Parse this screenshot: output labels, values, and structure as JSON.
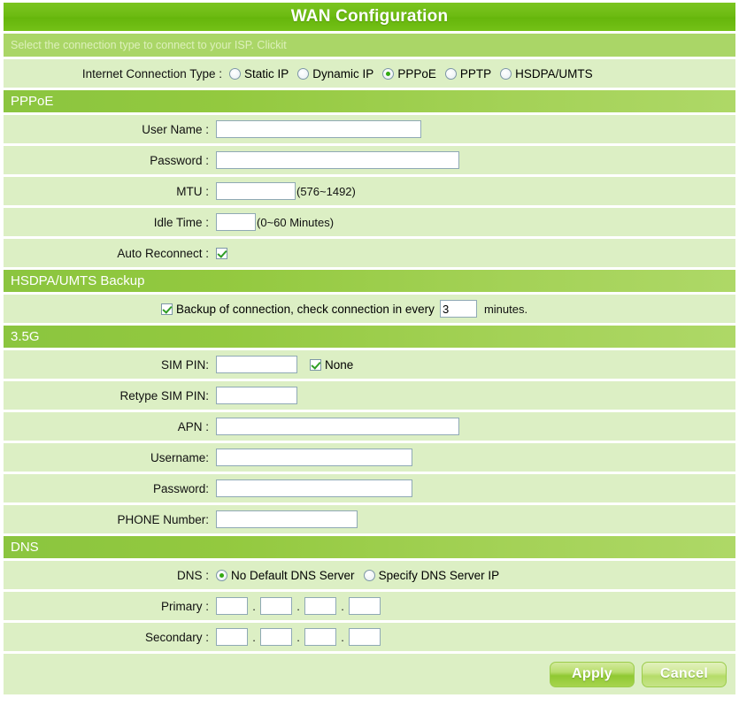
{
  "header": {
    "title": "WAN Configuration",
    "subtitle": "Select the connection type to connect to your ISP. Clickit"
  },
  "connection_type": {
    "label": "Internet Connection Type :",
    "options": [
      {
        "label": "Static IP",
        "selected": false
      },
      {
        "label": "Dynamic IP",
        "selected": false
      },
      {
        "label": "PPPoE",
        "selected": true
      },
      {
        "label": "PPTP",
        "selected": false
      },
      {
        "label": "HSDPA/UMTS",
        "selected": false
      }
    ]
  },
  "pppoe": {
    "section_title": "PPPoE",
    "user_name_label": "User Name :",
    "user_name_value": "",
    "password_label": "Password :",
    "password_value": "",
    "mtu_label": "MTU :",
    "mtu_value": "",
    "mtu_hint": "(576~1492)",
    "idle_time_label": "Idle Time :",
    "idle_time_value": "",
    "idle_time_hint": "(0~60 Minutes)",
    "auto_reconnect_label": "Auto Reconnect :",
    "auto_reconnect_checked": true
  },
  "hsdpa_backup": {
    "section_title": "HSDPA/UMTS Backup",
    "backup_checked": true,
    "backup_text_before": "Backup of connection, check connection in every",
    "backup_minutes_value": "3",
    "backup_text_after": "minutes."
  },
  "g35": {
    "section_title": "3.5G",
    "sim_pin_label": "SIM PIN:",
    "sim_pin_value": "",
    "sim_pin_none_label": "None",
    "sim_pin_none_checked": true,
    "retype_sim_pin_label": "Retype SIM PIN:",
    "retype_sim_pin_value": "",
    "apn_label": "APN :",
    "apn_value": "",
    "username_label": "Username:",
    "username_value": "",
    "password_label": "Password:",
    "password_value": "",
    "phone_number_label": "PHONE Number:",
    "phone_number_value": ""
  },
  "dns": {
    "section_title": "DNS",
    "dns_label": "DNS :",
    "options": [
      {
        "label": "No Default DNS Server",
        "selected": true
      },
      {
        "label": "Specify DNS Server IP",
        "selected": false
      }
    ],
    "primary_label": "Primary :",
    "primary_octets": [
      "",
      "",
      "",
      ""
    ],
    "secondary_label": "Secondary :",
    "secondary_octets": [
      "",
      "",
      "",
      ""
    ],
    "separator": "."
  },
  "actions": {
    "apply_label": "Apply",
    "cancel_label": "Cancel"
  },
  "colors": {
    "title_bar": "#6dbb12",
    "subtitle_bar": "#aad667",
    "section_header": "#8bc53f",
    "row_background": "#dcefc4",
    "radio_selected": "#33aa11",
    "check_mark": "#2f9e24"
  }
}
